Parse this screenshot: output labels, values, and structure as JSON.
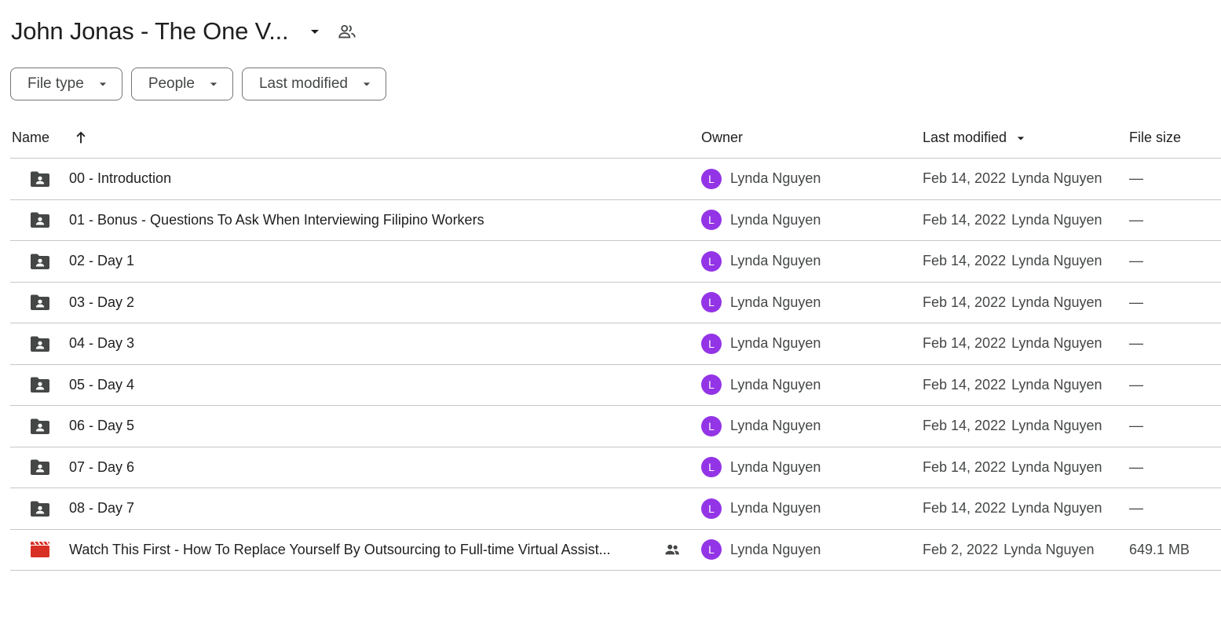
{
  "folder": {
    "title": "John Jonas - The One V..."
  },
  "filters": [
    {
      "label": "File type"
    },
    {
      "label": "People"
    },
    {
      "label": "Last modified"
    }
  ],
  "columns": {
    "name": "Name",
    "owner": "Owner",
    "last_modified": "Last modified",
    "file_size": "File size"
  },
  "files": [
    {
      "type": "shared-folder",
      "name": "00 - Introduction",
      "owner_initial": "L",
      "owner": "Lynda Nguyen",
      "modified_date": "Feb 14, 2022",
      "modified_by": "Lynda Nguyen",
      "size": "—"
    },
    {
      "type": "shared-folder",
      "name": "01 - Bonus - Questions To Ask When Interviewing Filipino Workers",
      "owner_initial": "L",
      "owner": "Lynda Nguyen",
      "modified_date": "Feb 14, 2022",
      "modified_by": "Lynda Nguyen",
      "size": "—"
    },
    {
      "type": "shared-folder",
      "name": "02 - Day 1",
      "owner_initial": "L",
      "owner": "Lynda Nguyen",
      "modified_date": "Feb 14, 2022",
      "modified_by": "Lynda Nguyen",
      "size": "—"
    },
    {
      "type": "shared-folder",
      "name": "03 - Day 2",
      "owner_initial": "L",
      "owner": "Lynda Nguyen",
      "modified_date": "Feb 14, 2022",
      "modified_by": "Lynda Nguyen",
      "size": "—"
    },
    {
      "type": "shared-folder",
      "name": "04 - Day 3",
      "owner_initial": "L",
      "owner": "Lynda Nguyen",
      "modified_date": "Feb 14, 2022",
      "modified_by": "Lynda Nguyen",
      "size": "—"
    },
    {
      "type": "shared-folder",
      "name": "05 - Day 4",
      "owner_initial": "L",
      "owner": "Lynda Nguyen",
      "modified_date": "Feb 14, 2022",
      "modified_by": "Lynda Nguyen",
      "size": "—"
    },
    {
      "type": "shared-folder",
      "name": "06 - Day 5",
      "owner_initial": "L",
      "owner": "Lynda Nguyen",
      "modified_date": "Feb 14, 2022",
      "modified_by": "Lynda Nguyen",
      "size": "—"
    },
    {
      "type": "shared-folder",
      "name": "07 - Day 6",
      "owner_initial": "L",
      "owner": "Lynda Nguyen",
      "modified_date": "Feb 14, 2022",
      "modified_by": "Lynda Nguyen",
      "size": "—"
    },
    {
      "type": "shared-folder",
      "name": "08 - Day 7",
      "owner_initial": "L",
      "owner": "Lynda Nguyen",
      "modified_date": "Feb 14, 2022",
      "modified_by": "Lynda Nguyen",
      "size": "—"
    },
    {
      "type": "video",
      "name": "Watch This First - How To Replace Yourself By Outsourcing to Full-time Virtual Assist...",
      "shared": true,
      "owner_initial": "L",
      "owner": "Lynda Nguyen",
      "modified_date": "Feb 2, 2022",
      "modified_by": "Lynda Nguyen",
      "size": "649.1 MB"
    }
  ],
  "icons": {
    "title_caret": "arrow-drop-down-icon",
    "title_shared": "people-outline-icon",
    "chip_caret": "arrow-drop-down-icon",
    "sort": "arrow-upward-icon",
    "folder": "shared-folder-icon",
    "video": "video-file-icon",
    "shared": "people-icon"
  },
  "colors": {
    "avatar": "#9334e6",
    "folder_icon": "#444746",
    "video_icon": "#d93025",
    "divider": "#c7c7c7"
  }
}
